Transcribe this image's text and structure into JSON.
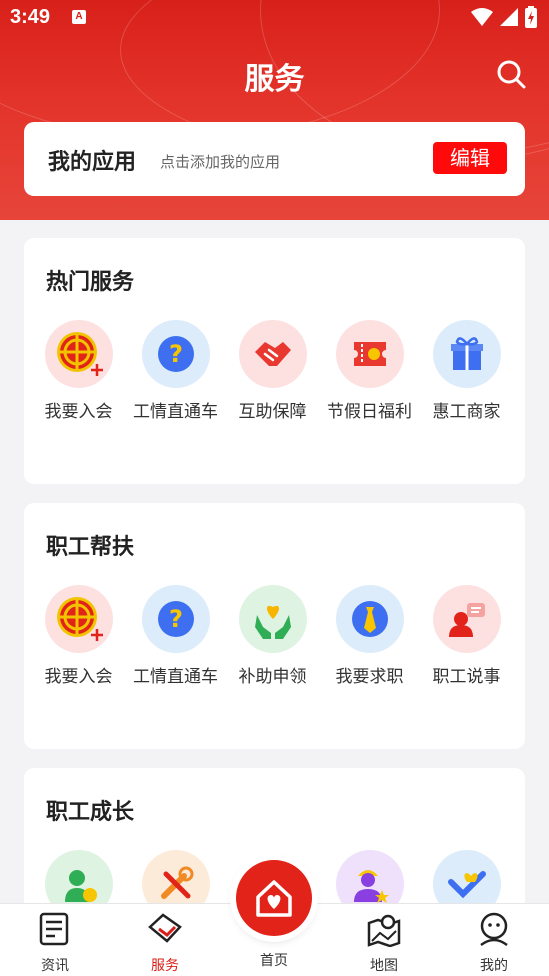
{
  "status_bar": {
    "time": "3:49",
    "app_icon": "A"
  },
  "header": {
    "title": "服务",
    "search_icon": "search-icon"
  },
  "my_apps": {
    "title": "我的应用",
    "hint": "点击添加我的应用",
    "edit_label": "编辑"
  },
  "sections": [
    {
      "title": "热门服务",
      "items": [
        {
          "label": "我要入会",
          "icon": "union-join-icon"
        },
        {
          "label": "工情直通车",
          "icon": "question-icon"
        },
        {
          "label": "互助保障",
          "icon": "handshake-icon"
        },
        {
          "label": "节假日福利",
          "icon": "ticket-icon"
        },
        {
          "label": "惠工商家",
          "icon": "gift-icon"
        }
      ]
    },
    {
      "title": "职工帮扶",
      "items": [
        {
          "label": "我要入会",
          "icon": "union-join-icon"
        },
        {
          "label": "工情直通车",
          "icon": "question-icon"
        },
        {
          "label": "补助申领",
          "icon": "heart-hands-icon"
        },
        {
          "label": "我要求职",
          "icon": "tie-icon"
        },
        {
          "label": "职工说事",
          "icon": "speaker-icon"
        }
      ]
    },
    {
      "title": "职工成长",
      "items": [
        {
          "label": "",
          "icon": "worker-coin-icon"
        },
        {
          "label": "",
          "icon": "tools-icon"
        },
        {
          "label": "",
          "icon": "hidden-icon"
        },
        {
          "label": "",
          "icon": "worker-star-icon"
        },
        {
          "label": "",
          "icon": "hands-heart-icon"
        }
      ]
    }
  ],
  "bottom_nav": {
    "news": "资讯",
    "service": "服务",
    "home": "首页",
    "map": "地图",
    "mine": "我的"
  },
  "colors": {
    "brand_red": "#d8201a",
    "edit_red": "#ff0a0a"
  }
}
